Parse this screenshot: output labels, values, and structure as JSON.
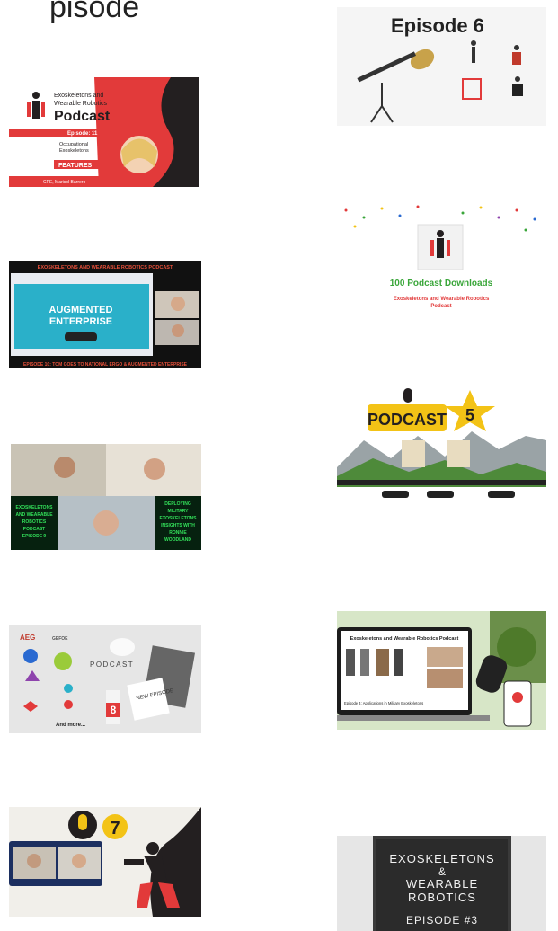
{
  "page": {
    "partial_heading": "pisode"
  },
  "tiles": {
    "ep11": {
      "line1": "Exoskeletons and",
      "line2": "Wearable Robotics",
      "line3": "Podcast",
      "episode": "Episode: 11",
      "topic1": "Occupational",
      "topic2": "Exoskeletons",
      "features": "FEATURES",
      "guest": "CPE, Marisol Barrero"
    },
    "ep6": {
      "title": "Episode 6"
    },
    "ep10": {
      "header": "EXOSKELETONS AND WEARABLE ROBOTICS PODCAST",
      "screen1": "AUGMENTED",
      "screen2": "ENTERPRISE",
      "footer": "EPISODE 10: TOM GOES TO NATIONAL ERGO & AUGMENTED ENTERPRISE"
    },
    "downloads": {
      "title": "100 Podcast Downloads",
      "subtitle1": "Exoskeletons and Wearable Robotics",
      "subtitle2": "Podcast"
    },
    "ep5": {
      "badge": "PODCAST",
      "number": "5"
    },
    "ep9": {
      "left1": "EXOSKELETONS",
      "left2": "AND WEARABLE",
      "left3": "ROBOTICS",
      "left4": "PODCAST",
      "left5": "EPISODE 9",
      "right1": "DEPLOYING",
      "right2": "MILITARY",
      "right3": "EXOSKELETONS",
      "right4": "INSIGHTS WITH",
      "right5": "RONNIE",
      "right6": "WOODLAND"
    },
    "ep8": {
      "logo1": "AEG",
      "logo2": "GEFOE",
      "podcast": "PODCAST",
      "new_ep": "NEW EPISODE",
      "number": "8",
      "more": "And more..."
    },
    "military": {
      "title": "Exoskeletons and Wearable Robotics Podcast",
      "caption": "Episode 4: Applications in Military Exoskeletons"
    },
    "ep7": {
      "number": "7"
    },
    "ep3": {
      "line1": "EXOSKELETONS",
      "line2": "&",
      "line3": "WEARABLE",
      "line4": "ROBOTICS",
      "line5": "EPISODE #3"
    }
  },
  "colors": {
    "brand_red": "#e23a3a",
    "dark": "#231f20",
    "podcast_yellow": "#f3c316",
    "green": "#3aa63a"
  }
}
